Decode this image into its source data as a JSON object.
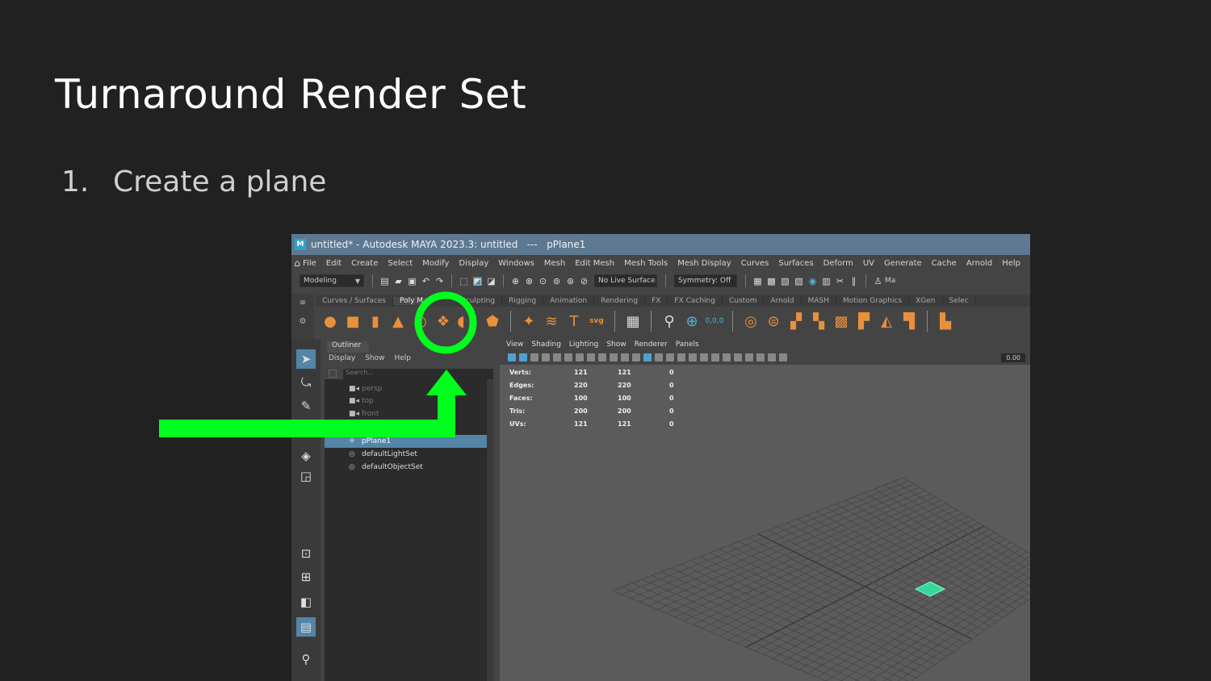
{
  "slide": {
    "title": "Turnaround Render Set",
    "step_number": "1.",
    "step_text": "Create a plane",
    "highlight_color": "#00ff1e"
  },
  "app": {
    "window_title": "untitled* - Autodesk MAYA 2023.3: untitled   ---   pPlane1",
    "logo": "M",
    "menus": [
      "File",
      "Edit",
      "Create",
      "Select",
      "Modify",
      "Display",
      "Windows",
      "Mesh",
      "Edit Mesh",
      "Mesh Tools",
      "Mesh Display",
      "Curves",
      "Surfaces",
      "Deform",
      "UV",
      "Generate",
      "Cache",
      "Arnold",
      "Help"
    ],
    "status": {
      "mode": "Modeling",
      "live_surface": "No Live Surface",
      "symmetry": "Symmetry: Off",
      "user": "Ma"
    },
    "shelf_tabs": [
      "Curves / Surfaces",
      "Poly Modeling",
      "Sculpting",
      "Rigging",
      "Animation",
      "Rendering",
      "FX",
      "FX Caching",
      "Custom",
      "Arnold",
      "MASH",
      "Motion Graphics",
      "XGen",
      "Select"
    ],
    "shelf_tabs_visible": [
      "Curves / Surfaces",
      "Poly M",
      "Sculpting",
      "Rigging",
      "Animation",
      "Rendering",
      "FX",
      "FX Caching",
      "Custom",
      "Arnold",
      "MASH",
      "Motion Graphics",
      "XGen",
      "Selec"
    ],
    "shelf_active": 1
  },
  "outliner": {
    "tab": "Outliner",
    "menu": [
      "Display",
      "Show",
      "Help"
    ],
    "search_placeholder": "Search...",
    "items": [
      {
        "label": "persp",
        "icon": "camera-icon",
        "state": "dim"
      },
      {
        "label": "top",
        "icon": "camera-icon",
        "state": "dim"
      },
      {
        "label": "front",
        "icon": "camera-icon",
        "state": "dim"
      },
      {
        "label": "pPlane1",
        "icon": "mesh-icon",
        "state": "selected"
      },
      {
        "label": "defaultLightSet",
        "icon": "set-icon",
        "state": "normal"
      },
      {
        "label": "defaultObjectSet",
        "icon": "set-icon",
        "state": "normal"
      }
    ]
  },
  "viewport": {
    "menu": [
      "View",
      "Shading",
      "Lighting",
      "Show",
      "Renderer",
      "Panels"
    ],
    "zero_field": "0.00",
    "hud": [
      {
        "label": "Verts:",
        "a": "121",
        "b": "121",
        "c": "0"
      },
      {
        "label": "Edges:",
        "a": "220",
        "b": "220",
        "c": "0"
      },
      {
        "label": "Faces:",
        "a": "100",
        "b": "100",
        "c": "0"
      },
      {
        "label": "Tris:",
        "a": "200",
        "b": "200",
        "c": "0"
      },
      {
        "label": "UVs:",
        "a": "121",
        "b": "121",
        "c": "0"
      }
    ],
    "origin_label": "0,0,0"
  }
}
